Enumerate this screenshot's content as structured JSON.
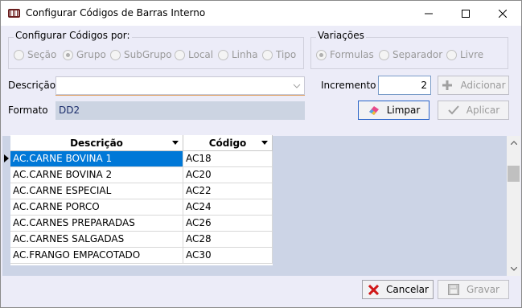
{
  "window": {
    "title": "Configurar Códigos de Barras Interno",
    "controls": {
      "minimize": "minimize",
      "maximize": "maximize",
      "close": "close"
    }
  },
  "configurar": {
    "title": "Configurar Códigos por:",
    "options": [
      {
        "label": "Seção",
        "checked": false
      },
      {
        "label": "Grupo",
        "checked": true
      },
      {
        "label": "SubGrupo",
        "checked": false
      },
      {
        "label": "Local",
        "checked": false
      },
      {
        "label": "Linha",
        "checked": false
      },
      {
        "label": "Tipo",
        "checked": false
      }
    ]
  },
  "variacoes": {
    "title": "Variações",
    "options": [
      {
        "label": "Formulas",
        "checked": true
      },
      {
        "label": "Separador",
        "checked": false
      },
      {
        "label": "Livre",
        "checked": false
      }
    ]
  },
  "form": {
    "descricao_label": "Descrição",
    "descricao_value": "",
    "formato_label": "Formato",
    "formato_value": "DD2",
    "incremento_label": "Incremento",
    "incremento_value": "2"
  },
  "buttons": {
    "adicionar": "Adicionar",
    "limpar": "Limpar",
    "aplicar": "Aplicar",
    "cancelar": "Cancelar",
    "gravar": "Gravar"
  },
  "grid": {
    "columns": [
      "Descrição",
      "Código"
    ],
    "rows": [
      [
        "AC.CARNE BOVINA 1",
        "AC18"
      ],
      [
        "AC.CARNE BOVINA 2",
        "AC20"
      ],
      [
        "AC.CARNE ESPECIAL",
        "AC22"
      ],
      [
        "AC.CARNE PORCO",
        "AC24"
      ],
      [
        "AC.CARNES PREPARADAS",
        "AC26"
      ],
      [
        "AC.CARNES SALGADAS",
        "AC28"
      ],
      [
        "AC.FRANGO EMPACOTADO",
        "AC30"
      ]
    ],
    "selected_row": 0
  },
  "colors": {
    "accent": "#0078d7",
    "panel": "#ccd4e6",
    "client": "#ececf8"
  }
}
